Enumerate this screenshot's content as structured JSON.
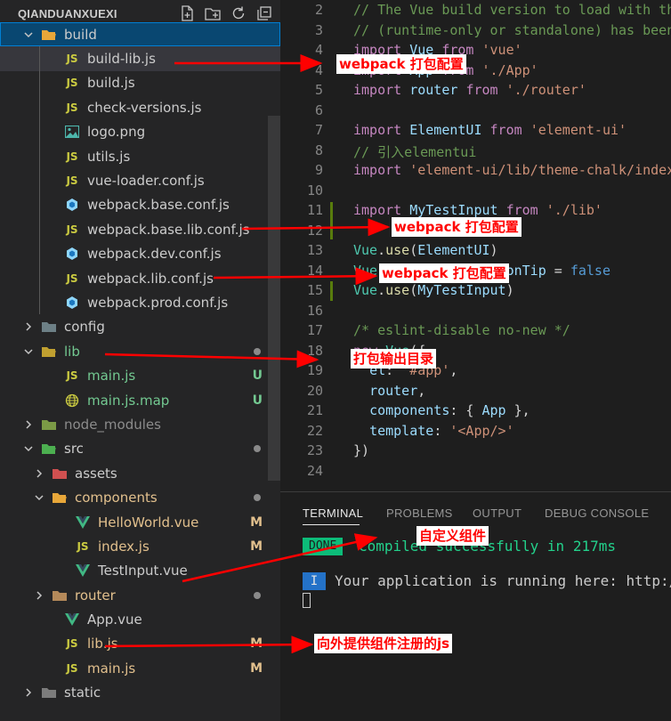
{
  "explorer": {
    "title": "QIANDUANXUEXI",
    "actions": [
      "new-file-icon",
      "new-folder-icon",
      "refresh-icon",
      "collapse-all-icon"
    ]
  },
  "tree": [
    {
      "label": "build",
      "kind": "folder",
      "depth": 0,
      "open": true,
      "icon": "folder-open-icon",
      "status": "",
      "active": true
    },
    {
      "label": "build-lib.js",
      "kind": "js",
      "depth": 1,
      "status": "",
      "selected": true
    },
    {
      "label": "build.js",
      "kind": "js",
      "depth": 1,
      "status": ""
    },
    {
      "label": "check-versions.js",
      "kind": "js",
      "depth": 1,
      "status": ""
    },
    {
      "label": "logo.png",
      "kind": "image",
      "depth": 1,
      "status": ""
    },
    {
      "label": "utils.js",
      "kind": "js",
      "depth": 1,
      "status": ""
    },
    {
      "label": "vue-loader.conf.js",
      "kind": "js",
      "depth": 1,
      "status": ""
    },
    {
      "label": "webpack.base.conf.js",
      "kind": "webpack",
      "depth": 1,
      "status": ""
    },
    {
      "label": "webpack.base.lib.conf.js",
      "kind": "js",
      "depth": 1,
      "status": ""
    },
    {
      "label": "webpack.dev.conf.js",
      "kind": "webpack",
      "depth": 1,
      "status": ""
    },
    {
      "label": "webpack.lib.conf.js",
      "kind": "js",
      "depth": 1,
      "status": ""
    },
    {
      "label": "webpack.prod.conf.js",
      "kind": "webpack",
      "depth": 1,
      "status": ""
    },
    {
      "label": "config",
      "kind": "folder",
      "depth": 0,
      "open": false,
      "icon": "folder-config-icon",
      "status": ""
    },
    {
      "label": "lib",
      "kind": "folder",
      "depth": 0,
      "open": true,
      "icon": "folder-lib-icon",
      "status": "dot",
      "color": "git"
    },
    {
      "label": "main.js",
      "kind": "js",
      "depth": 1,
      "status": "U",
      "color": "git"
    },
    {
      "label": "main.js.map",
      "kind": "map",
      "depth": 1,
      "status": "U",
      "color": "git"
    },
    {
      "label": "node_modules",
      "kind": "folder",
      "depth": 0,
      "open": false,
      "icon": "folder-node-icon",
      "status": "",
      "color": "dim"
    },
    {
      "label": "src",
      "kind": "folder",
      "depth": 0,
      "open": true,
      "icon": "folder-src-icon",
      "status": "dot"
    },
    {
      "label": "assets",
      "kind": "folder",
      "depth": 1,
      "open": false,
      "icon": "folder-assets-icon",
      "status": ""
    },
    {
      "label": "components",
      "kind": "folder",
      "depth": 1,
      "open": true,
      "icon": "folder-components-icon",
      "status": "dot",
      "color": "mod"
    },
    {
      "label": "HelloWorld.vue",
      "kind": "vue",
      "depth": 2,
      "status": "M",
      "color": "mod"
    },
    {
      "label": "index.js",
      "kind": "js",
      "depth": 2,
      "status": "M",
      "color": "mod"
    },
    {
      "label": "TestInput.vue",
      "kind": "vue",
      "depth": 2,
      "status": ""
    },
    {
      "label": "router",
      "kind": "folder",
      "depth": 1,
      "open": false,
      "icon": "folder-router-icon",
      "status": "dot",
      "color": "mod"
    },
    {
      "label": "App.vue",
      "kind": "vue",
      "depth": 1,
      "status": ""
    },
    {
      "label": "lib.js",
      "kind": "js",
      "depth": 1,
      "status": "M",
      "color": "mod"
    },
    {
      "label": "main.js",
      "kind": "js",
      "depth": 1,
      "status": "M",
      "color": "mod"
    },
    {
      "label": "static",
      "kind": "folder",
      "depth": 0,
      "open": false,
      "icon": "folder-static-icon",
      "status": ""
    }
  ],
  "editor": {
    "lines": [
      {
        "n": "2",
        "tokens": [
          [
            "com",
            "// The Vue build version to load with th"
          ]
        ]
      },
      {
        "n": "3",
        "tokens": [
          [
            "com",
            "// (runtime-only or standalone) has been"
          ]
        ]
      },
      {
        "n": "4",
        "tokens": [
          [
            "kw",
            "import "
          ],
          [
            "var",
            "Vue "
          ],
          [
            "kw",
            "from "
          ],
          [
            "str",
            "'vue'"
          ]
        ]
      },
      {
        "n": "4",
        "tokens": [
          [
            "kw",
            "import "
          ],
          [
            "var",
            "App "
          ],
          [
            "kw",
            "from "
          ],
          [
            "str",
            "'./App'"
          ]
        ]
      },
      {
        "n": "5",
        "tokens": [
          [
            "kw",
            "import "
          ],
          [
            "var",
            "router "
          ],
          [
            "kw",
            "from "
          ],
          [
            "str",
            "'./router'"
          ]
        ]
      },
      {
        "n": "6",
        "tokens": []
      },
      {
        "n": "7",
        "tokens": [
          [
            "kw",
            "import "
          ],
          [
            "var",
            "ElementUI "
          ],
          [
            "kw",
            "from "
          ],
          [
            "str",
            "'element-ui'"
          ]
        ]
      },
      {
        "n": "8",
        "tokens": [
          [
            "com",
            "// 引入elementui"
          ]
        ]
      },
      {
        "n": "9",
        "tokens": [
          [
            "kw",
            "import "
          ],
          [
            "str",
            "'element-ui/lib/theme-chalk/index"
          ]
        ]
      },
      {
        "n": "10",
        "tokens": []
      },
      {
        "n": "11",
        "tokens": [
          [
            "kw",
            "import "
          ],
          [
            "var",
            "MyTestInput "
          ],
          [
            "kw",
            "from "
          ],
          [
            "str",
            "'./lib'"
          ]
        ]
      },
      {
        "n": "12",
        "tokens": []
      },
      {
        "n": "13",
        "tokens": [
          [
            "cls",
            "Vue"
          ],
          [
            "pun",
            "."
          ],
          [
            "fn",
            "use"
          ],
          [
            "pun",
            "("
          ],
          [
            "var",
            "ElementUI"
          ],
          [
            "pun",
            ")"
          ]
        ]
      },
      {
        "n": "14",
        "tokens": [
          [
            "cls",
            "Vue"
          ],
          [
            "pun",
            "."
          ],
          [
            "var",
            "config"
          ],
          [
            "pun",
            "."
          ],
          [
            "var",
            "productionTip "
          ],
          [
            "pun",
            "= "
          ],
          [
            "bool",
            "false"
          ]
        ]
      },
      {
        "n": "15",
        "tokens": [
          [
            "cls",
            "Vue"
          ],
          [
            "pun",
            "."
          ],
          [
            "fn",
            "use"
          ],
          [
            "pun",
            "("
          ],
          [
            "var",
            "MyTestInput"
          ],
          [
            "pun",
            ")"
          ]
        ]
      },
      {
        "n": "16",
        "tokens": []
      },
      {
        "n": "17",
        "tokens": [
          [
            "com",
            "/* eslint-disable no-new */"
          ]
        ]
      },
      {
        "n": "18",
        "tokens": [
          [
            "kw",
            "new "
          ],
          [
            "cls",
            "Vue"
          ],
          [
            "pun",
            "({"
          ]
        ]
      },
      {
        "n": "19",
        "tokens": [
          [
            "pun",
            "  "
          ],
          [
            "var",
            "el"
          ],
          [
            "pun",
            ": "
          ],
          [
            "str",
            "'#app'"
          ],
          [
            "pun",
            ","
          ]
        ]
      },
      {
        "n": "20",
        "tokens": [
          [
            "pun",
            "  "
          ],
          [
            "var",
            "router"
          ],
          [
            "pun",
            ","
          ]
        ]
      },
      {
        "n": "21",
        "tokens": [
          [
            "pun",
            "  "
          ],
          [
            "var",
            "components"
          ],
          [
            "pun",
            ": { "
          ],
          [
            "var",
            "App "
          ],
          [
            "pun",
            "},"
          ]
        ]
      },
      {
        "n": "22",
        "tokens": [
          [
            "pun",
            "  "
          ],
          [
            "var",
            "template"
          ],
          [
            "pun",
            ": "
          ],
          [
            "str",
            "'<App/>'"
          ]
        ]
      },
      {
        "n": "23",
        "tokens": [
          [
            "pun",
            "})"
          ]
        ]
      },
      {
        "n": "24",
        "tokens": []
      }
    ]
  },
  "panel": {
    "tabs": [
      "TERMINAL",
      "PROBLEMS",
      "OUTPUT",
      "DEBUG CONSOLE"
    ],
    "active_tab": "TERMINAL",
    "done_badge": "DONE",
    "compiled_text": "Compiled successfully in 217ms",
    "info_badge": "I",
    "running_text": "Your application is running here: http://l"
  },
  "annotations": {
    "a1": "webpack 打包配置",
    "a2": "webpack 打包配置",
    "a3": "webpack 打包配置",
    "a4": "打包输出目录",
    "a5": "自定义组件",
    "a6": "向外提供组件注册的js"
  },
  "colors": {
    "annotation": "#ff0000",
    "active_row": "#094771",
    "git_untracked": "#73c991",
    "git_modified": "#e2c08d"
  }
}
